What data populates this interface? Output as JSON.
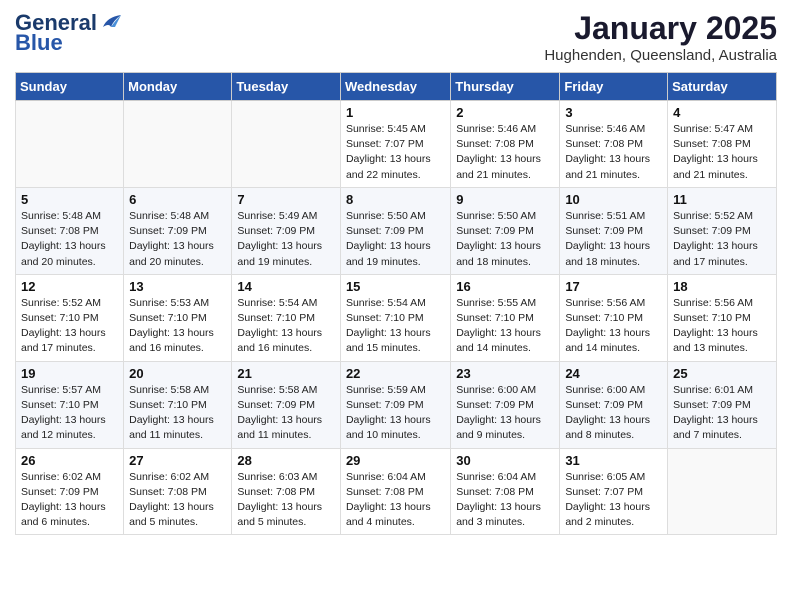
{
  "header": {
    "logo_line1": "General",
    "logo_line2": "Blue",
    "month": "January 2025",
    "location": "Hughenden, Queensland, Australia"
  },
  "weekdays": [
    "Sunday",
    "Monday",
    "Tuesday",
    "Wednesday",
    "Thursday",
    "Friday",
    "Saturday"
  ],
  "weeks": [
    [
      {
        "day": "",
        "info": ""
      },
      {
        "day": "",
        "info": ""
      },
      {
        "day": "",
        "info": ""
      },
      {
        "day": "1",
        "info": "Sunrise: 5:45 AM\nSunset: 7:07 PM\nDaylight: 13 hours\nand 22 minutes."
      },
      {
        "day": "2",
        "info": "Sunrise: 5:46 AM\nSunset: 7:08 PM\nDaylight: 13 hours\nand 21 minutes."
      },
      {
        "day": "3",
        "info": "Sunrise: 5:46 AM\nSunset: 7:08 PM\nDaylight: 13 hours\nand 21 minutes."
      },
      {
        "day": "4",
        "info": "Sunrise: 5:47 AM\nSunset: 7:08 PM\nDaylight: 13 hours\nand 21 minutes."
      }
    ],
    [
      {
        "day": "5",
        "info": "Sunrise: 5:48 AM\nSunset: 7:08 PM\nDaylight: 13 hours\nand 20 minutes."
      },
      {
        "day": "6",
        "info": "Sunrise: 5:48 AM\nSunset: 7:09 PM\nDaylight: 13 hours\nand 20 minutes."
      },
      {
        "day": "7",
        "info": "Sunrise: 5:49 AM\nSunset: 7:09 PM\nDaylight: 13 hours\nand 19 minutes."
      },
      {
        "day": "8",
        "info": "Sunrise: 5:50 AM\nSunset: 7:09 PM\nDaylight: 13 hours\nand 19 minutes."
      },
      {
        "day": "9",
        "info": "Sunrise: 5:50 AM\nSunset: 7:09 PM\nDaylight: 13 hours\nand 18 minutes."
      },
      {
        "day": "10",
        "info": "Sunrise: 5:51 AM\nSunset: 7:09 PM\nDaylight: 13 hours\nand 18 minutes."
      },
      {
        "day": "11",
        "info": "Sunrise: 5:52 AM\nSunset: 7:09 PM\nDaylight: 13 hours\nand 17 minutes."
      }
    ],
    [
      {
        "day": "12",
        "info": "Sunrise: 5:52 AM\nSunset: 7:10 PM\nDaylight: 13 hours\nand 17 minutes."
      },
      {
        "day": "13",
        "info": "Sunrise: 5:53 AM\nSunset: 7:10 PM\nDaylight: 13 hours\nand 16 minutes."
      },
      {
        "day": "14",
        "info": "Sunrise: 5:54 AM\nSunset: 7:10 PM\nDaylight: 13 hours\nand 16 minutes."
      },
      {
        "day": "15",
        "info": "Sunrise: 5:54 AM\nSunset: 7:10 PM\nDaylight: 13 hours\nand 15 minutes."
      },
      {
        "day": "16",
        "info": "Sunrise: 5:55 AM\nSunset: 7:10 PM\nDaylight: 13 hours\nand 14 minutes."
      },
      {
        "day": "17",
        "info": "Sunrise: 5:56 AM\nSunset: 7:10 PM\nDaylight: 13 hours\nand 14 minutes."
      },
      {
        "day": "18",
        "info": "Sunrise: 5:56 AM\nSunset: 7:10 PM\nDaylight: 13 hours\nand 13 minutes."
      }
    ],
    [
      {
        "day": "19",
        "info": "Sunrise: 5:57 AM\nSunset: 7:10 PM\nDaylight: 13 hours\nand 12 minutes."
      },
      {
        "day": "20",
        "info": "Sunrise: 5:58 AM\nSunset: 7:10 PM\nDaylight: 13 hours\nand 11 minutes."
      },
      {
        "day": "21",
        "info": "Sunrise: 5:58 AM\nSunset: 7:09 PM\nDaylight: 13 hours\nand 11 minutes."
      },
      {
        "day": "22",
        "info": "Sunrise: 5:59 AM\nSunset: 7:09 PM\nDaylight: 13 hours\nand 10 minutes."
      },
      {
        "day": "23",
        "info": "Sunrise: 6:00 AM\nSunset: 7:09 PM\nDaylight: 13 hours\nand 9 minutes."
      },
      {
        "day": "24",
        "info": "Sunrise: 6:00 AM\nSunset: 7:09 PM\nDaylight: 13 hours\nand 8 minutes."
      },
      {
        "day": "25",
        "info": "Sunrise: 6:01 AM\nSunset: 7:09 PM\nDaylight: 13 hours\nand 7 minutes."
      }
    ],
    [
      {
        "day": "26",
        "info": "Sunrise: 6:02 AM\nSunset: 7:09 PM\nDaylight: 13 hours\nand 6 minutes."
      },
      {
        "day": "27",
        "info": "Sunrise: 6:02 AM\nSunset: 7:08 PM\nDaylight: 13 hours\nand 5 minutes."
      },
      {
        "day": "28",
        "info": "Sunrise: 6:03 AM\nSunset: 7:08 PM\nDaylight: 13 hours\nand 5 minutes."
      },
      {
        "day": "29",
        "info": "Sunrise: 6:04 AM\nSunset: 7:08 PM\nDaylight: 13 hours\nand 4 minutes."
      },
      {
        "day": "30",
        "info": "Sunrise: 6:04 AM\nSunset: 7:08 PM\nDaylight: 13 hours\nand 3 minutes."
      },
      {
        "day": "31",
        "info": "Sunrise: 6:05 AM\nSunset: 7:07 PM\nDaylight: 13 hours\nand 2 minutes."
      },
      {
        "day": "",
        "info": ""
      }
    ]
  ]
}
